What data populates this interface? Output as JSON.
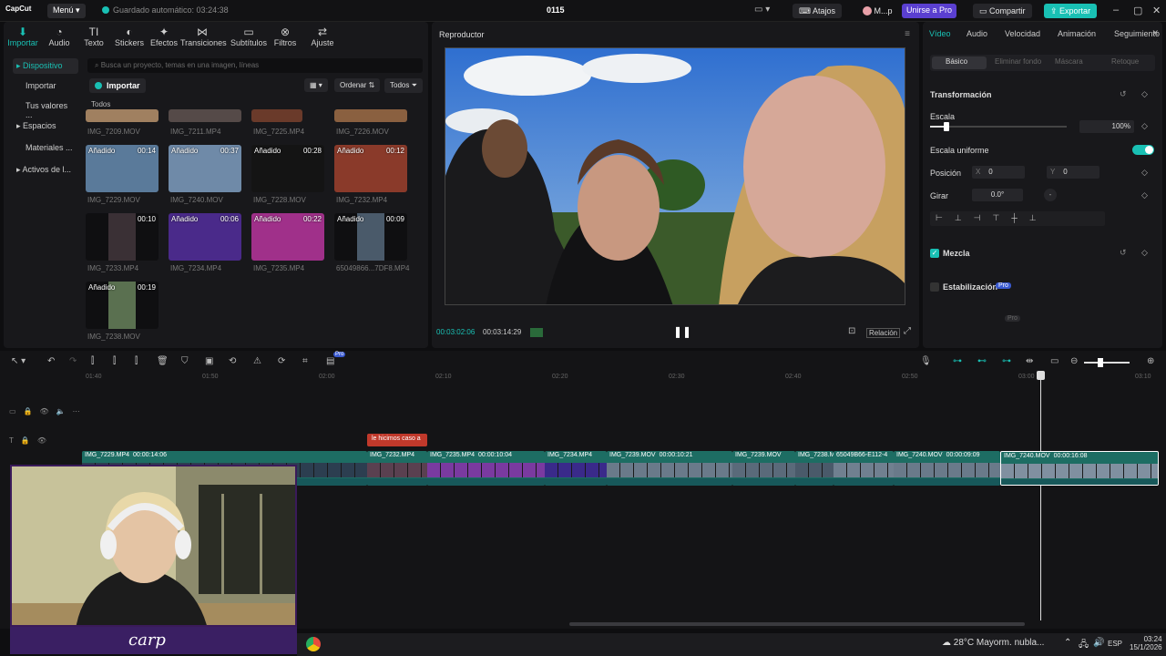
{
  "titlebar": {
    "app_logo": "CapCut",
    "menu": "Menú",
    "autosave": "Guardado automático: 03:24:38",
    "project_name": "0115",
    "shortcuts": "Atajos",
    "user": "M...p",
    "join_pro": "Unirse a Pro",
    "share": "Compartir",
    "export": "Exportar"
  },
  "media_tabs": [
    {
      "label": "Importar",
      "icon": "import-icon"
    },
    {
      "label": "Audio",
      "icon": "audio-icon"
    },
    {
      "label": "Texto",
      "icon": "text-icon"
    },
    {
      "label": "Stickers",
      "icon": "sticker-icon"
    },
    {
      "label": "Efectos",
      "icon": "effects-icon"
    },
    {
      "label": "Transiciones",
      "icon": "transition-icon"
    },
    {
      "label": "Subtítulos",
      "icon": "subtitle-icon"
    },
    {
      "label": "Filtros",
      "icon": "filter-icon"
    },
    {
      "label": "Ajuste",
      "icon": "adjust-icon"
    }
  ],
  "sidebar": {
    "items": [
      "Dispositivo",
      "Importar",
      "Tus valores ...",
      "Espacios",
      "Materiales ...",
      "Activos de l..."
    ]
  },
  "media": {
    "search_placeholder": "Busca un proyecto, temas en una imagen, líneas",
    "import_label": "Importar",
    "sort_label": "Ordenar",
    "filter_label": "Todos",
    "section_label": "Todos",
    "top_row": [
      "IMG_7209.MOV",
      "IMG_7211.MP4",
      "IMG_7225.MP4",
      "IMG_7226.MOV"
    ],
    "thumbnails": [
      {
        "badge": "Añadido",
        "duration": "00:14",
        "name": "IMG_7229.MOV",
        "color": "#5a7a9a"
      },
      {
        "badge": "Añadido",
        "duration": "00:37",
        "name": "IMG_7240.MOV",
        "color": "#6f8aa8"
      },
      {
        "badge": "Añadido",
        "duration": "00:28",
        "name": "IMG_7228.MOV",
        "color": "#141414"
      },
      {
        "badge": "Añadido",
        "duration": "00:12",
        "name": "IMG_7232.MP4",
        "color": "#8a3a2a"
      },
      {
        "badge": "",
        "duration": "00:10",
        "name": "IMG_7233.MP4",
        "color": "#3a3035"
      },
      {
        "badge": "Añadido",
        "duration": "00:06",
        "name": "IMG_7234.MP4",
        "color": "#4a2a8a"
      },
      {
        "badge": "Añadido",
        "duration": "00:22",
        "name": "IMG_7235.MP4",
        "color": "#a0308a"
      },
      {
        "badge": "Añadido",
        "duration": "00:09",
        "name": "65049866...7DF8.MP4",
        "color": "#4a5a6a"
      },
      {
        "badge": "Añadido",
        "duration": "00:19",
        "name": "IMG_7238.MOV",
        "color": "#5a7050"
      }
    ]
  },
  "player": {
    "title": "Reproductor",
    "current_time": "00:03:02:06",
    "total_time": "00:03:14:29",
    "ratio_label": "Relación"
  },
  "properties": {
    "tabs": [
      "Vídeo",
      "Audio",
      "Velocidad",
      "Animación",
      "Seguimiento"
    ],
    "subtabs": [
      "Básico",
      "Eliminar fondo",
      "Máscara",
      "Retoque"
    ],
    "transform_title": "Transformación",
    "scale_label": "Escala",
    "scale_value": "100%",
    "scale_level": 0.12,
    "uniform_label": "Escala uniforme",
    "position_label": "Posición",
    "pos_x_label": "X",
    "pos_x": "0",
    "pos_y_label": "Y",
    "pos_y": "0",
    "rotate_label": "Girar",
    "rotate_value": "0.0°",
    "blend_label": "Mezcla",
    "stabilize_label": "Estabilización",
    "pro_badge": "Pro"
  },
  "timeline": {
    "ruler": [
      "01:40",
      "01:50",
      "02:00",
      "02:10",
      "02:20",
      "02:30",
      "02:40",
      "02:50",
      "03:00",
      "03:10"
    ],
    "text_clip": "le hicimos caso a",
    "clips": [
      {
        "name": "IMG_7229.MP4",
        "dur": "00:00:14:06"
      },
      {
        "name": "IMG_7232.MP4",
        "dur": ""
      },
      {
        "name": "IMG_7235.MP4",
        "dur": "00:00:10:04"
      },
      {
        "name": "IMG_7234.MP4",
        "dur": ""
      },
      {
        "name": "IMG_7239.MOV",
        "dur": "00:00:10:21"
      },
      {
        "name": "IMG_7239.MOV",
        "dur": ""
      },
      {
        "name": "IMG_7238.MOV",
        "dur": ""
      },
      {
        "name": "65049B66-E112-4",
        "dur": ""
      },
      {
        "name": "IMG_7240.MOV",
        "dur": "00:00:09:09"
      },
      {
        "name": "IMG_7240.MOV",
        "dur": "00:00:16:08"
      }
    ]
  },
  "webcam": {
    "overlay_text": "carp"
  },
  "taskbar": {
    "weather": "28°C  Mayorm. nubla...",
    "lang": "ESP",
    "time": "03:24",
    "date": "15/1/2026"
  },
  "colors": {
    "accent": "#19c0b4",
    "clip": "#1d6d63",
    "text_clip": "#c0392b"
  }
}
